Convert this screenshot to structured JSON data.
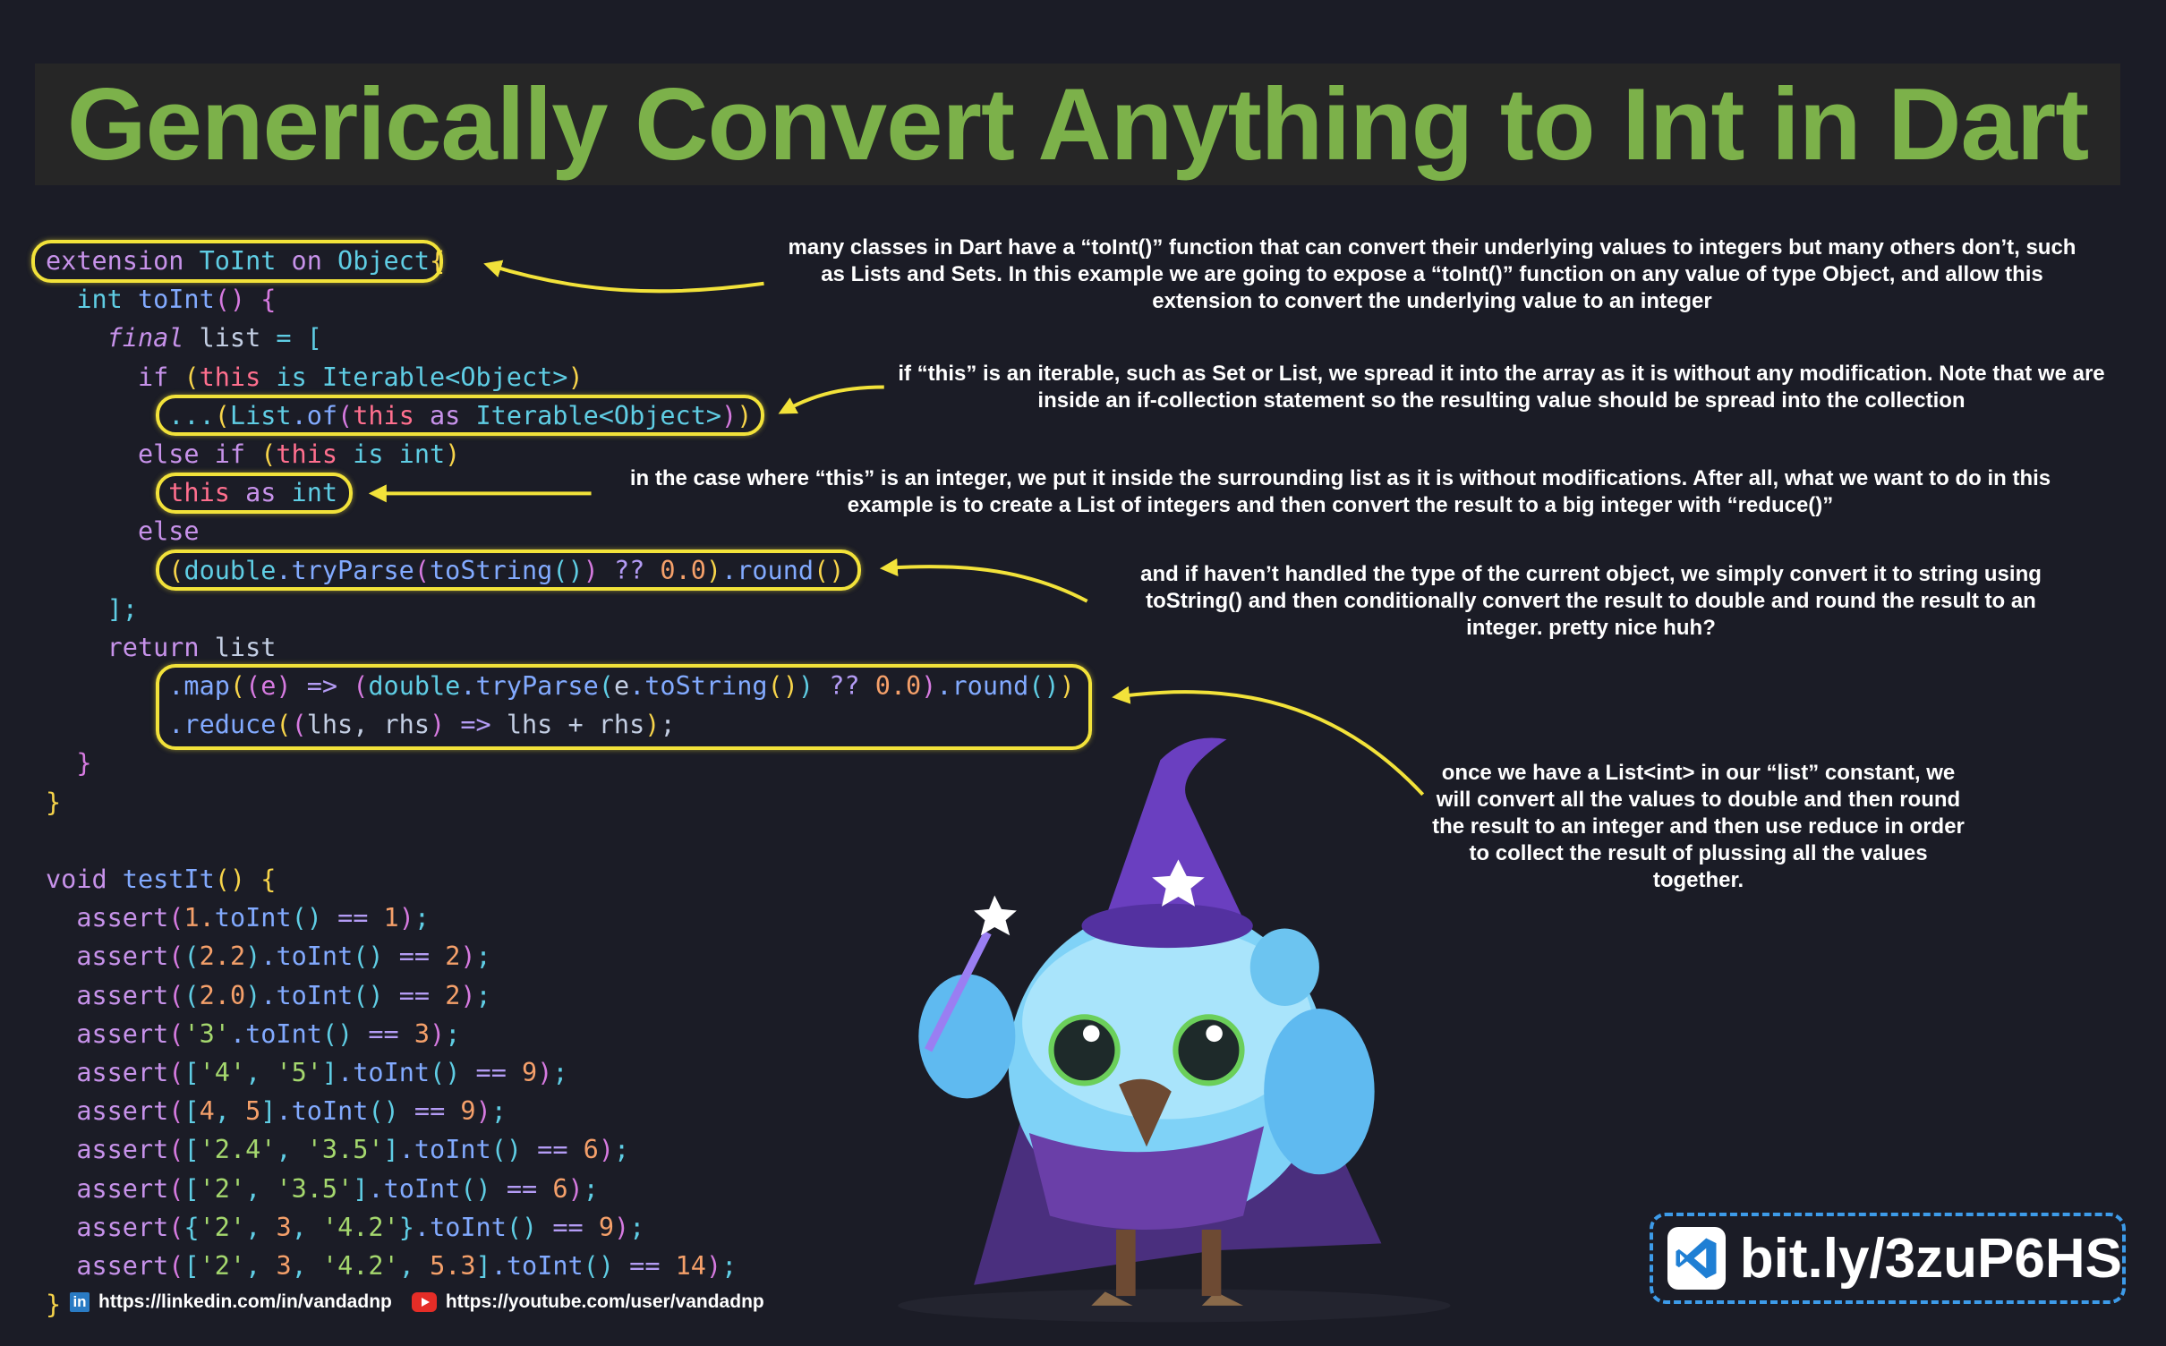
{
  "title": "Generically Convert Anything to Int in Dart",
  "colors": {
    "k": "#c792ea",
    "t": "#5fcde4",
    "f": "#82aaff",
    "p": "#c3cee3",
    "y": "#f7d44a",
    "m": "#d67ae0",
    "r": "#ff6f8e",
    "n": "#f5a06a",
    "s": "#a5d86e",
    "o": "#b49cf5",
    "highlight": "#f2e23a",
    "title": "#7cb14a",
    "badge_border": "#3d9be9"
  },
  "code": [
    [
      [
        "extension ",
        "k"
      ],
      [
        "ToInt ",
        "t"
      ],
      [
        "on ",
        "k"
      ],
      [
        "Object",
        "t"
      ],
      [
        "{",
        "y"
      ]
    ],
    [
      [
        "  int ",
        "t"
      ],
      [
        "toInt",
        "f"
      ],
      [
        "()",
        "m"
      ],
      [
        " {",
        "m"
      ]
    ],
    [
      [
        "    final ",
        "k"
      ],
      [
        "list ",
        "p"
      ],
      [
        "= ",
        "t"
      ],
      [
        "[",
        "t"
      ]
    ],
    [
      [
        "      if ",
        "k"
      ],
      [
        "(",
        "y"
      ],
      [
        "this ",
        "r"
      ],
      [
        "is ",
        "t"
      ],
      [
        "Iterable<Object>",
        "t"
      ],
      [
        ")",
        "y"
      ]
    ],
    [
      [
        "        ...",
        "t"
      ],
      [
        "(",
        "y"
      ],
      [
        "List",
        "t"
      ],
      [
        ".of",
        "f"
      ],
      [
        "(",
        "m"
      ],
      [
        "this ",
        "r"
      ],
      [
        "as ",
        "k"
      ],
      [
        "Iterable<Object>",
        "t"
      ],
      [
        ")",
        "m"
      ],
      [
        ")",
        "y"
      ]
    ],
    [
      [
        "      else if ",
        "k"
      ],
      [
        "(",
        "y"
      ],
      [
        "this ",
        "r"
      ],
      [
        "is ",
        "t"
      ],
      [
        "int",
        "t"
      ],
      [
        ")",
        "y"
      ]
    ],
    [
      [
        "        this ",
        "r"
      ],
      [
        "as ",
        "k"
      ],
      [
        "int",
        "t"
      ]
    ],
    [
      [
        "      else",
        "k"
      ]
    ],
    [
      [
        "        (",
        "y"
      ],
      [
        "double",
        "t"
      ],
      [
        ".tryParse",
        "f"
      ],
      [
        "(",
        "m"
      ],
      [
        "toString",
        "f"
      ],
      [
        "()",
        "t"
      ],
      [
        ")",
        "m"
      ],
      [
        " ?? ",
        "o"
      ],
      [
        "0.0",
        "n"
      ],
      [
        ")",
        "y"
      ],
      [
        ".round",
        "f"
      ],
      [
        "()",
        "y"
      ]
    ],
    [
      [
        "    ];",
        "t"
      ]
    ],
    [
      [
        "    return ",
        "k"
      ],
      [
        "list",
        "p"
      ]
    ],
    [
      [
        "        .map",
        "f"
      ],
      [
        "(",
        "y"
      ],
      [
        "(e)",
        "m"
      ],
      [
        " => ",
        "o"
      ],
      [
        "(",
        "m"
      ],
      [
        "double",
        "t"
      ],
      [
        ".tryParse",
        "f"
      ],
      [
        "(",
        "t"
      ],
      [
        "e",
        "p"
      ],
      [
        ".toString",
        "f"
      ],
      [
        "()",
        "y"
      ],
      [
        ")",
        "t"
      ],
      [
        " ?? ",
        "o"
      ],
      [
        "0.0",
        "n"
      ],
      [
        ")",
        "m"
      ],
      [
        ".round",
        "f"
      ],
      [
        "()",
        "t"
      ],
      [
        ")",
        "y"
      ]
    ],
    [
      [
        "        .reduce",
        "f"
      ],
      [
        "(",
        "y"
      ],
      [
        "(",
        "m"
      ],
      [
        "lhs, rhs",
        "p"
      ],
      [
        ")",
        "m"
      ],
      [
        " => ",
        "o"
      ],
      [
        "lhs + rhs",
        "p"
      ],
      [
        ")",
        "y"
      ],
      [
        ";",
        "p"
      ]
    ],
    [
      [
        "  }",
        "m"
      ]
    ],
    [
      [
        "}",
        "y"
      ]
    ],
    [],
    [
      [
        "void ",
        "k"
      ],
      [
        "testIt",
        "f"
      ],
      [
        "()",
        "y"
      ],
      [
        " {",
        "y"
      ]
    ],
    [
      [
        "  assert",
        "k"
      ],
      [
        "(",
        "m"
      ],
      [
        "1.",
        "n"
      ],
      [
        "toInt",
        "f"
      ],
      [
        "()",
        "t"
      ],
      [
        " == ",
        "o"
      ],
      [
        "1",
        "n"
      ],
      [
        ")",
        "m"
      ],
      [
        ";",
        "t"
      ]
    ],
    [
      [
        "  assert",
        "k"
      ],
      [
        "(",
        "m"
      ],
      [
        "(",
        "t"
      ],
      [
        "2.2",
        "n"
      ],
      [
        ")",
        "t"
      ],
      [
        ".toInt",
        "f"
      ],
      [
        "()",
        "t"
      ],
      [
        " == ",
        "o"
      ],
      [
        "2",
        "n"
      ],
      [
        ")",
        "m"
      ],
      [
        ";",
        "t"
      ]
    ],
    [
      [
        "  assert",
        "k"
      ],
      [
        "(",
        "m"
      ],
      [
        "(",
        "t"
      ],
      [
        "2.0",
        "n"
      ],
      [
        ")",
        "t"
      ],
      [
        ".toInt",
        "f"
      ],
      [
        "()",
        "t"
      ],
      [
        " == ",
        "o"
      ],
      [
        "2",
        "n"
      ],
      [
        ")",
        "m"
      ],
      [
        ";",
        "t"
      ]
    ],
    [
      [
        "  assert",
        "k"
      ],
      [
        "(",
        "m"
      ],
      [
        "'3'",
        "s"
      ],
      [
        ".toInt",
        "f"
      ],
      [
        "()",
        "t"
      ],
      [
        " == ",
        "o"
      ],
      [
        "3",
        "n"
      ],
      [
        ")",
        "m"
      ],
      [
        ";",
        "t"
      ]
    ],
    [
      [
        "  assert",
        "k"
      ],
      [
        "(",
        "m"
      ],
      [
        "[",
        "t"
      ],
      [
        "'4'",
        "s"
      ],
      [
        ", ",
        "t"
      ],
      [
        "'5'",
        "s"
      ],
      [
        "]",
        "t"
      ],
      [
        ".toInt",
        "f"
      ],
      [
        "()",
        "t"
      ],
      [
        " == ",
        "o"
      ],
      [
        "9",
        "n"
      ],
      [
        ")",
        "m"
      ],
      [
        ";",
        "t"
      ]
    ],
    [
      [
        "  assert",
        "k"
      ],
      [
        "(",
        "m"
      ],
      [
        "[",
        "t"
      ],
      [
        "4",
        "n"
      ],
      [
        ", ",
        "t"
      ],
      [
        "5",
        "n"
      ],
      [
        "]",
        "t"
      ],
      [
        ".toInt",
        "f"
      ],
      [
        "()",
        "t"
      ],
      [
        " == ",
        "o"
      ],
      [
        "9",
        "n"
      ],
      [
        ")",
        "m"
      ],
      [
        ";",
        "t"
      ]
    ],
    [
      [
        "  assert",
        "k"
      ],
      [
        "(",
        "m"
      ],
      [
        "[",
        "t"
      ],
      [
        "'2.4'",
        "s"
      ],
      [
        ", ",
        "t"
      ],
      [
        "'3.5'",
        "s"
      ],
      [
        "]",
        "t"
      ],
      [
        ".toInt",
        "f"
      ],
      [
        "()",
        "t"
      ],
      [
        " == ",
        "o"
      ],
      [
        "6",
        "n"
      ],
      [
        ")",
        "m"
      ],
      [
        ";",
        "t"
      ]
    ],
    [
      [
        "  assert",
        "k"
      ],
      [
        "(",
        "m"
      ],
      [
        "[",
        "t"
      ],
      [
        "'2'",
        "s"
      ],
      [
        ", ",
        "t"
      ],
      [
        "'3.5'",
        "s"
      ],
      [
        "]",
        "t"
      ],
      [
        ".toInt",
        "f"
      ],
      [
        "()",
        "t"
      ],
      [
        " == ",
        "o"
      ],
      [
        "6",
        "n"
      ],
      [
        ")",
        "m"
      ],
      [
        ";",
        "t"
      ]
    ],
    [
      [
        "  assert",
        "k"
      ],
      [
        "(",
        "m"
      ],
      [
        "{",
        "t"
      ],
      [
        "'2'",
        "s"
      ],
      [
        ", ",
        "t"
      ],
      [
        "3",
        "n"
      ],
      [
        ", ",
        "t"
      ],
      [
        "'4.2'",
        "s"
      ],
      [
        "}",
        "t"
      ],
      [
        ".toInt",
        "f"
      ],
      [
        "()",
        "t"
      ],
      [
        " == ",
        "o"
      ],
      [
        "9",
        "n"
      ],
      [
        ")",
        "m"
      ],
      [
        ";",
        "t"
      ]
    ],
    [
      [
        "  assert",
        "k"
      ],
      [
        "(",
        "m"
      ],
      [
        "[",
        "t"
      ],
      [
        "'2'",
        "s"
      ],
      [
        ", ",
        "t"
      ],
      [
        "3",
        "n"
      ],
      [
        ", ",
        "t"
      ],
      [
        "'4.2'",
        "s"
      ],
      [
        ", ",
        "t"
      ],
      [
        "5.3",
        "n"
      ],
      [
        "]",
        "t"
      ],
      [
        ".toInt",
        "f"
      ],
      [
        "()",
        "t"
      ],
      [
        " == ",
        "o"
      ],
      [
        "14",
        "n"
      ],
      [
        ")",
        "m"
      ],
      [
        ";",
        "t"
      ]
    ],
    [
      [
        "}",
        "y"
      ]
    ]
  ],
  "annotations": {
    "extension": "many classes in Dart have a “toInt()” function that can convert their underlying values to integers but many others don’t, such as Lists and Sets. In this example we are going to expose a “toInt()” function on any value of type Object, and allow this extension to convert the underlying value to an integer",
    "iterable": "if “this” is an iterable, such as Set or List, we spread it into the array as it is without any modification. Note that we are inside an if-collection statement so the resulting value should be spread into the collection",
    "integer": "in the case where “this” is an integer, we put it inside the surrounding list as it is without modifications. After all, what we want to do in this example is to create a List of integers and then convert the result to a big integer with “reduce()”",
    "other": "and if haven’t handled the type of the current object, we simply convert it to string using toString() and then conditionally convert the result to double and round the result to an integer. pretty nice huh?",
    "reduce": "once we have a List<int> in our “list” constant, we will convert all the values to double and then round the result to an integer and then use reduce in order to collect the result of plussing all the values together."
  },
  "footer": {
    "linkedin_icon": "linkedin-icon",
    "linkedin": "https://linkedin.com/in/vandadnp",
    "youtube_icon": "youtube-icon",
    "youtube": "https://youtube.com/user/vandadnp"
  },
  "badge": {
    "icon": "vscode-icon",
    "text": "bit.ly/3zuP6HS"
  }
}
